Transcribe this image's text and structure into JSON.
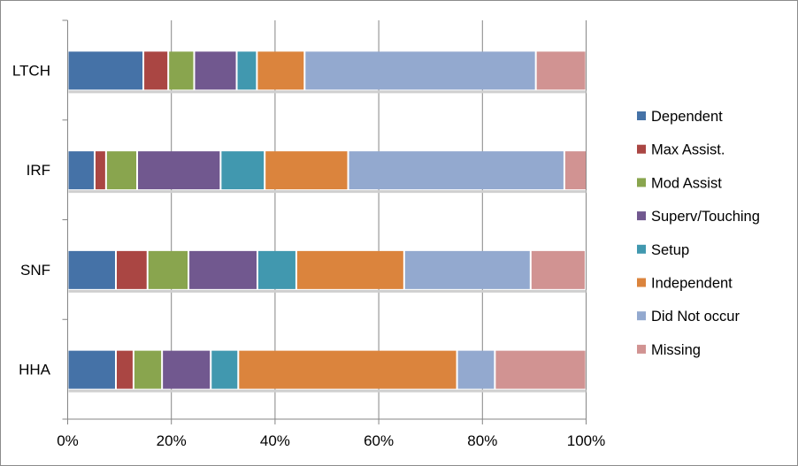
{
  "chart_data": {
    "type": "bar",
    "orientation": "horizontal",
    "stacked": "percent",
    "title": "",
    "xlabel": "",
    "ylabel": "",
    "xlim": [
      0,
      100
    ],
    "x_ticks": [
      "0%",
      "20%",
      "40%",
      "60%",
      "80%",
      "100%"
    ],
    "x_tick_values": [
      0,
      20,
      40,
      60,
      80,
      100
    ],
    "grid": "vertical major gridlines",
    "legend_position": "right",
    "categories": [
      "LTCH",
      "IRF",
      "SNF",
      "HHA"
    ],
    "series": [
      {
        "name": "Dependent",
        "color": "#4572A7",
        "values": [
          14.6,
          5.2,
          9.3,
          9.3
        ]
      },
      {
        "name": "Max Assist.",
        "color": "#AA4643",
        "values": [
          4.8,
          2.2,
          6.1,
          3.4
        ]
      },
      {
        "name": "Mod Assist",
        "color": "#89A54E",
        "values": [
          5.0,
          6.0,
          7.9,
          5.5
        ]
      },
      {
        "name": "Superv/Touching",
        "color": "#71588F",
        "values": [
          8.2,
          16.1,
          13.3,
          9.4
        ]
      },
      {
        "name": "Setup",
        "color": "#4198AF",
        "values": [
          3.9,
          8.5,
          7.5,
          5.3
        ]
      },
      {
        "name": "Independent",
        "color": "#DB843D",
        "values": [
          9.2,
          16.1,
          20.8,
          42.2
        ]
      },
      {
        "name": "Did Not occur",
        "color": "#93A9CF",
        "values": [
          44.6,
          41.7,
          24.4,
          7.3
        ]
      },
      {
        "name": "Missing",
        "color": "#D19392",
        "values": [
          9.7,
          4.3,
          10.6,
          17.6
        ]
      }
    ]
  }
}
